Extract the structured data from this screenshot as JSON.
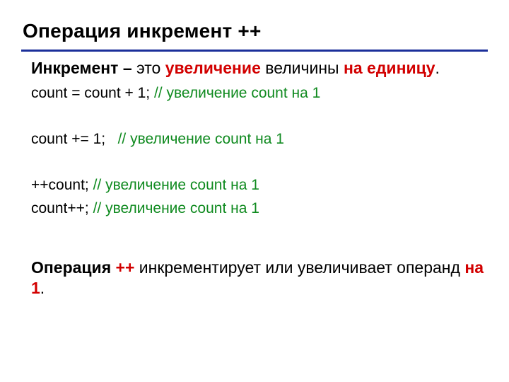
{
  "title": "Операция инкремент    ++",
  "definition": {
    "w1": "Инкремент",
    "dash": " – ",
    "w2": "это ",
    "w3": "увеличение",
    "w4": " величины ",
    "w5": "на единицу",
    "period": "."
  },
  "code": {
    "l1a": "count = count + 1; ",
    "l1b": "// увеличение count на 1",
    "l2a": "count += 1;   ",
    "l2b": "// увеличение count на 1",
    "l3a": "++count; ",
    "l3b": "// увеличение count на 1",
    "l4a": "count++; ",
    "l4b": "// увеличение count на 1"
  },
  "summary": {
    "s1": "Операция ",
    "s2": "++",
    "s3": " инкрементирует или увеличивает операнд ",
    "s4": "на 1",
    "s5": "."
  }
}
